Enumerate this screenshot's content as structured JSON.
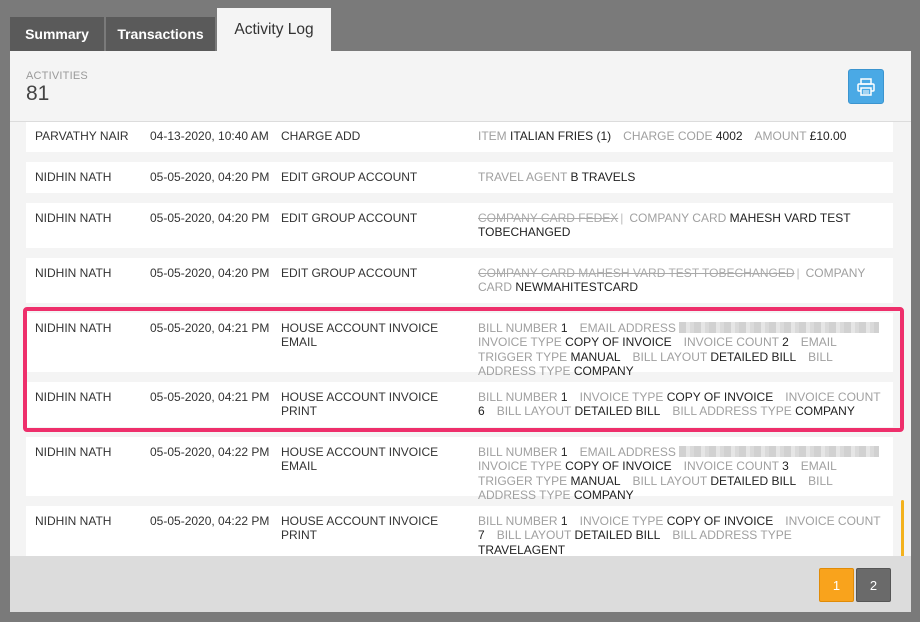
{
  "tabs": [
    {
      "label": "Summary",
      "active": false
    },
    {
      "label": "Transactions",
      "active": false
    },
    {
      "label": "Activity Log",
      "active": true
    }
  ],
  "header": {
    "activities_label": "ACTIVITIES",
    "activities_count": "81"
  },
  "icons": {
    "print": "printer-icon"
  },
  "colors": {
    "accent": "#4aa9e5",
    "highlight": "#ee2f6b",
    "pager_active": "#f9a31c"
  },
  "rows": [
    {
      "user": "PARVATHY NAIR",
      "date": "04-13-2020, 10:40 AM",
      "action": "CHARGE ADD",
      "details": {
        "item_k": "ITEM",
        "item_v": "ITALIAN FRIES (1)",
        "code_k": "CHARGE CODE",
        "code_v": "4002",
        "amount_k": "AMOUNT",
        "amount_v": "£10.00"
      }
    },
    {
      "user": "NIDHIN NATH",
      "date": "05-05-2020, 04:20 PM",
      "action": "EDIT GROUP ACCOUNT",
      "details": {
        "ta_k": "TRAVEL AGENT",
        "ta_v": "B TRAVELS"
      }
    },
    {
      "user": "NIDHIN NATH",
      "date": "05-05-2020, 04:20 PM",
      "action": "EDIT GROUP ACCOUNT",
      "details": {
        "old": "COMPANY CARD FEDEX",
        "sep": "|",
        "cc_k": "COMPANY CARD",
        "cc_v": "MAHESH VARD TEST TOBECHANGED"
      }
    },
    {
      "user": "NIDHIN NATH",
      "date": "05-05-2020, 04:20 PM",
      "action": "EDIT GROUP ACCOUNT",
      "details": {
        "old": "COMPANY CARD MAHESH VARD TEST TOBECHANGED",
        "sep": "|",
        "cc_k": "COMPANY CARD",
        "cc_v": "NEWMAHITESTCARD"
      }
    },
    {
      "user": "NIDHIN NATH",
      "date": "05-05-2020, 04:21 PM",
      "action": "HOUSE ACCOUNT INVOICE EMAIL",
      "details": {
        "bn_k": "BILL NUMBER",
        "bn_v": "1",
        "ea_k": "EMAIL ADDRESS",
        "it_k": "INVOICE TYPE",
        "it_v": "COPY OF INVOICE",
        "ic_k": "INVOICE COUNT",
        "ic_v": "2",
        "et_k": "EMAIL TRIGGER TYPE",
        "et_v": "MANUAL",
        "bl_k": "BILL LAYOUT",
        "bl_v": "DETAILED BILL",
        "ba_k": "BILL ADDRESS TYPE",
        "ba_v": "COMPANY"
      }
    },
    {
      "user": "NIDHIN NATH",
      "date": "05-05-2020, 04:21 PM",
      "action": "HOUSE ACCOUNT INVOICE PRINT",
      "details": {
        "bn_k": "BILL NUMBER",
        "bn_v": "1",
        "it_k": "INVOICE TYPE",
        "it_v": "COPY OF INVOICE",
        "ic_k": "INVOICE COUNT",
        "ic_v": "6",
        "bl_k": "BILL LAYOUT",
        "bl_v": "DETAILED BILL",
        "ba_k": "BILL ADDRESS TYPE",
        "ba_v": "COMPANY"
      }
    },
    {
      "user": "NIDHIN NATH",
      "date": "05-05-2020, 04:22 PM",
      "action": "HOUSE ACCOUNT INVOICE EMAIL",
      "details": {
        "bn_k": "BILL NUMBER",
        "bn_v": "1",
        "ea_k": "EMAIL ADDRESS",
        "it_k": "INVOICE TYPE",
        "it_v": "COPY OF INVOICE",
        "ic_k": "INVOICE COUNT",
        "ic_v": "3",
        "et_k": "EMAIL TRIGGER TYPE",
        "et_v": "MANUAL",
        "bl_k": "BILL LAYOUT",
        "bl_v": "DETAILED BILL",
        "ba_k": "BILL ADDRESS TYPE",
        "ba_v": "COMPANY"
      }
    },
    {
      "user": "NIDHIN NATH",
      "date": "05-05-2020, 04:22 PM",
      "action": "HOUSE ACCOUNT INVOICE PRINT",
      "details": {
        "bn_k": "BILL NUMBER",
        "bn_v": "1",
        "it_k": "INVOICE TYPE",
        "it_v": "COPY OF INVOICE",
        "ic_k": "INVOICE COUNT",
        "ic_v": "7",
        "bl_k": "BILL LAYOUT",
        "bl_v": "DETAILED BILL",
        "ba_k": "BILL ADDRESS TYPE",
        "ba_v": "TRAVELAGENT"
      }
    }
  ],
  "pagination": {
    "pages": [
      "1",
      "2"
    ],
    "current": "1"
  }
}
